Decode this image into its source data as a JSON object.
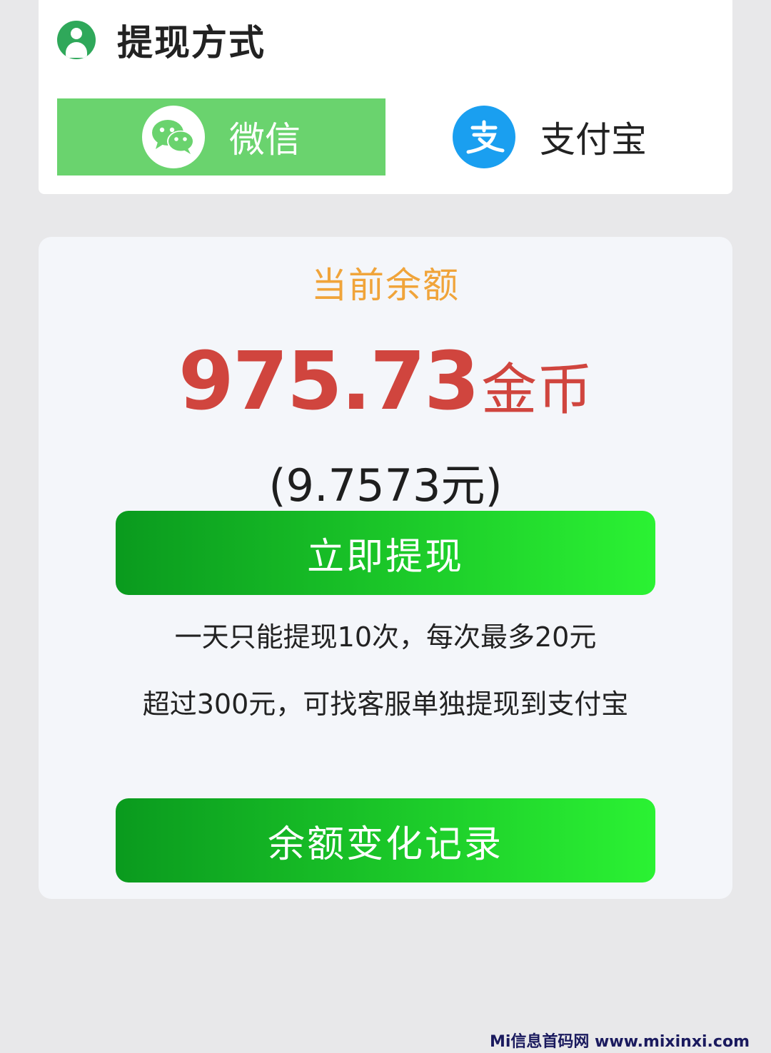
{
  "withdraw_method": {
    "title": "提现方式",
    "options": [
      {
        "label": "微信",
        "icon": "wechat-icon",
        "selected": true
      },
      {
        "label": "支付宝",
        "icon": "alipay-icon",
        "selected": false
      }
    ]
  },
  "balance": {
    "label": "当前余额",
    "amount": "975.73",
    "unit": "金币",
    "yuan_equivalent": "(9.7573元)"
  },
  "actions": {
    "withdraw_label": "立即提现",
    "history_label": "余额变化记录"
  },
  "rules": [
    "一天只能提现10次，每次最多20元",
    "超过300元，可找客服单独提现到支付宝"
  ],
  "watermark": "Mi信息首码网 www.mixinxi.com",
  "colors": {
    "selected_option": "#6ad36e",
    "balance_label": "#f0a43a",
    "amount": "#d0453e",
    "button_gradient_start": "#0a9a1e",
    "button_gradient_end": "#2bf233",
    "alipay_blue": "#1a9ff0"
  }
}
